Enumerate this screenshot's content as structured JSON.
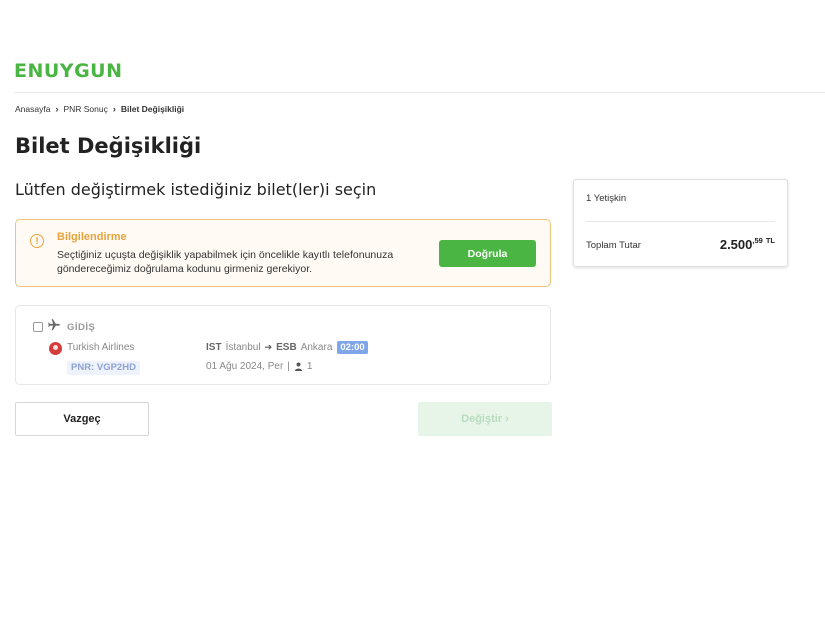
{
  "brand": {
    "logo_text": "ENUYGUN",
    "accent_color": "#4bb543"
  },
  "breadcrumb": {
    "items": [
      "Anasayfa",
      "PNR Sonuç"
    ],
    "current": "Bilet Değişikliği"
  },
  "page": {
    "title": "Bilet Değişikliği",
    "subtitle": "Lütfen değiştirmek istediğiniz bilet(ler)i seçin"
  },
  "info": {
    "title": "Bilgilendirme",
    "text": "Seçtiğiniz uçuşta değişiklik yapabilmek için öncelikle kayıtlı telefonunuza göndereceğimiz doğrulama kodunu girmeniz gerekiyor.",
    "verify_label": "Doğrula",
    "icon": "warning-circle-icon"
  },
  "flight": {
    "direction": "GİDİŞ",
    "airline": "Turkish Airlines",
    "pnr": "PNR: VGP2HD",
    "from_code": "IST",
    "from_city": "İstanbul",
    "to_code": "ESB",
    "to_city": "Ankara",
    "duration": "02:00",
    "date": "01 Ağu 2024, Per",
    "passengers": "1",
    "checked": false
  },
  "actions": {
    "cancel_label": "Vazgeç",
    "change_label": "Değiştir"
  },
  "summary": {
    "pax": "1 Yetişkin",
    "total_label": "Toplam Tutar",
    "total_main": "2.500",
    "total_decimal": ",59",
    "currency": "TL"
  }
}
